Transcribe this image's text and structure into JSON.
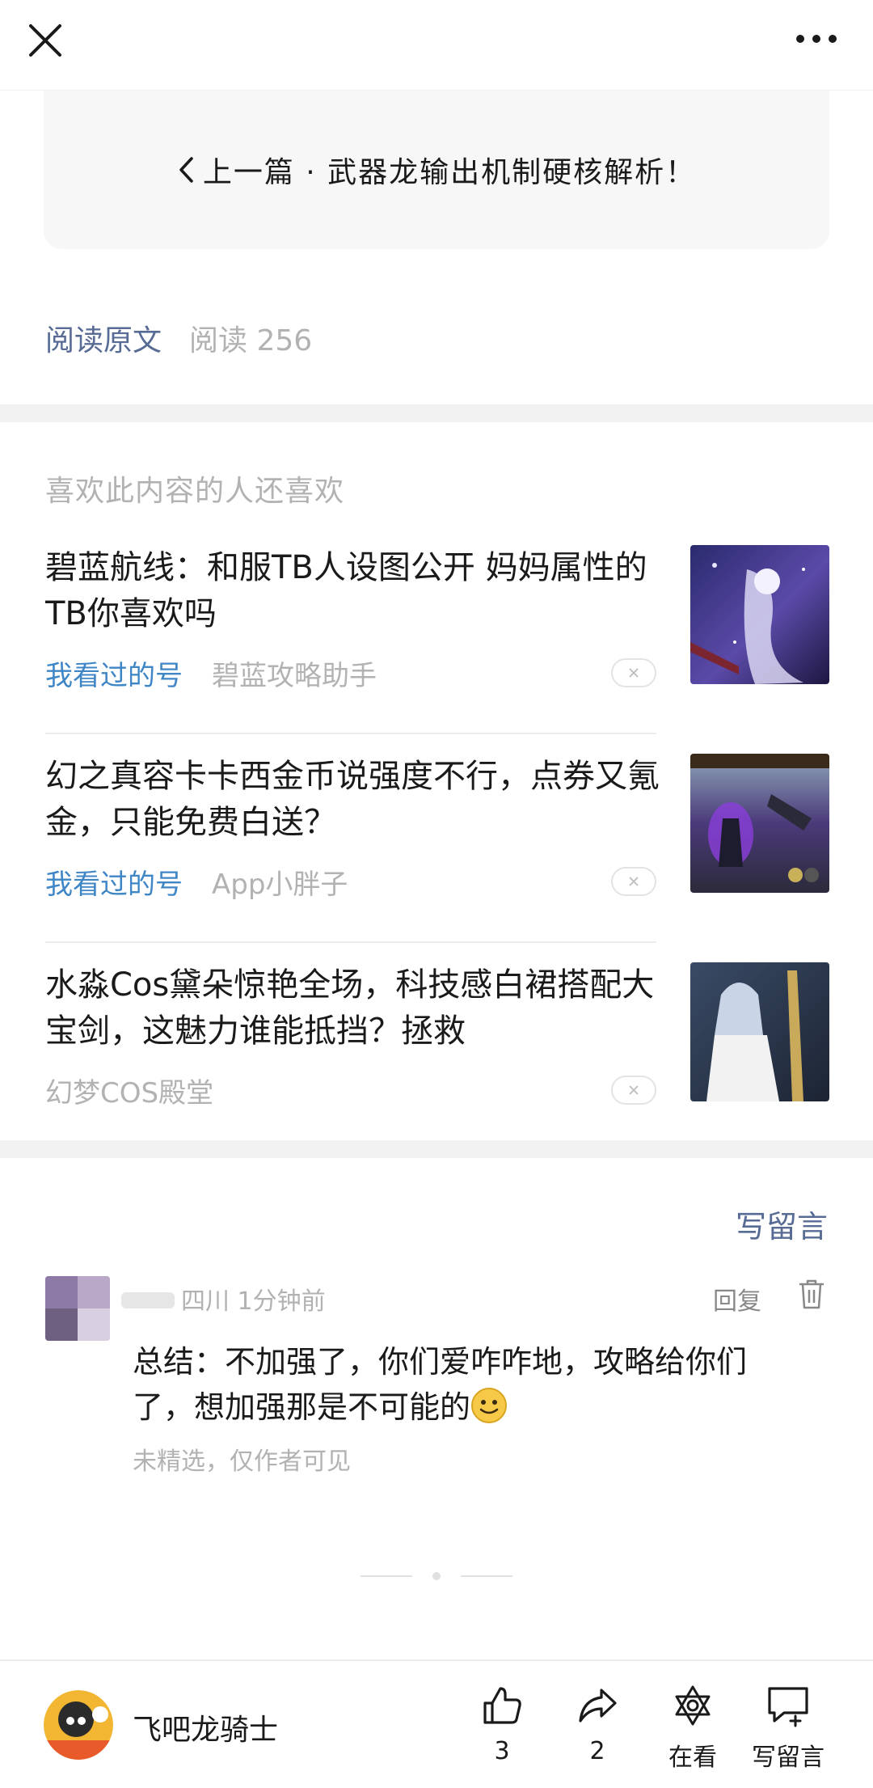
{
  "header": {
    "close_icon": "close-icon",
    "more_icon": "more-dots-icon"
  },
  "prev_article": {
    "label": "上一篇 · 武器龙输出机制硬核解析！"
  },
  "read_row": {
    "original_label": "阅读原文",
    "read_label": "阅读 256"
  },
  "recommend": {
    "title": "喜欢此内容的人还喜欢",
    "items": [
      {
        "title": "碧蓝航线：和服TB人设图公开 妈妈属性的TB你喜欢吗",
        "tag": "我看过的号",
        "source": "碧蓝攻略助手"
      },
      {
        "title": "幻之真容卡卡西金币说强度不行，点券又氪金，只能免费白送？",
        "tag": "我看过的号",
        "source": "App小胖子"
      },
      {
        "title": "水淼Cos黛朵惊艳全场，科技感白裙搭配大宝剑，这魅力谁能抵挡？拯救",
        "tag": "",
        "source": "幻梦COS殿堂"
      }
    ]
  },
  "comments": {
    "write_label": "写留言",
    "items": [
      {
        "meta": "四川 1分钟前",
        "reply": "回复",
        "text": "总结：不加强了，你们爱咋咋地，攻略给你们了，想加强那是不可能的",
        "note": "未精选，仅作者可见"
      }
    ]
  },
  "bottom_bar": {
    "account_name": "飞吧龙骑士",
    "like_count": "3",
    "share_count": "2",
    "watching_label": "在看",
    "comment_label": "写留言"
  },
  "colors": {
    "link_blue": "#576b95",
    "tag_blue": "#3f86c6",
    "muted": "#b2b2b2",
    "separator": "#f2f2f2"
  }
}
